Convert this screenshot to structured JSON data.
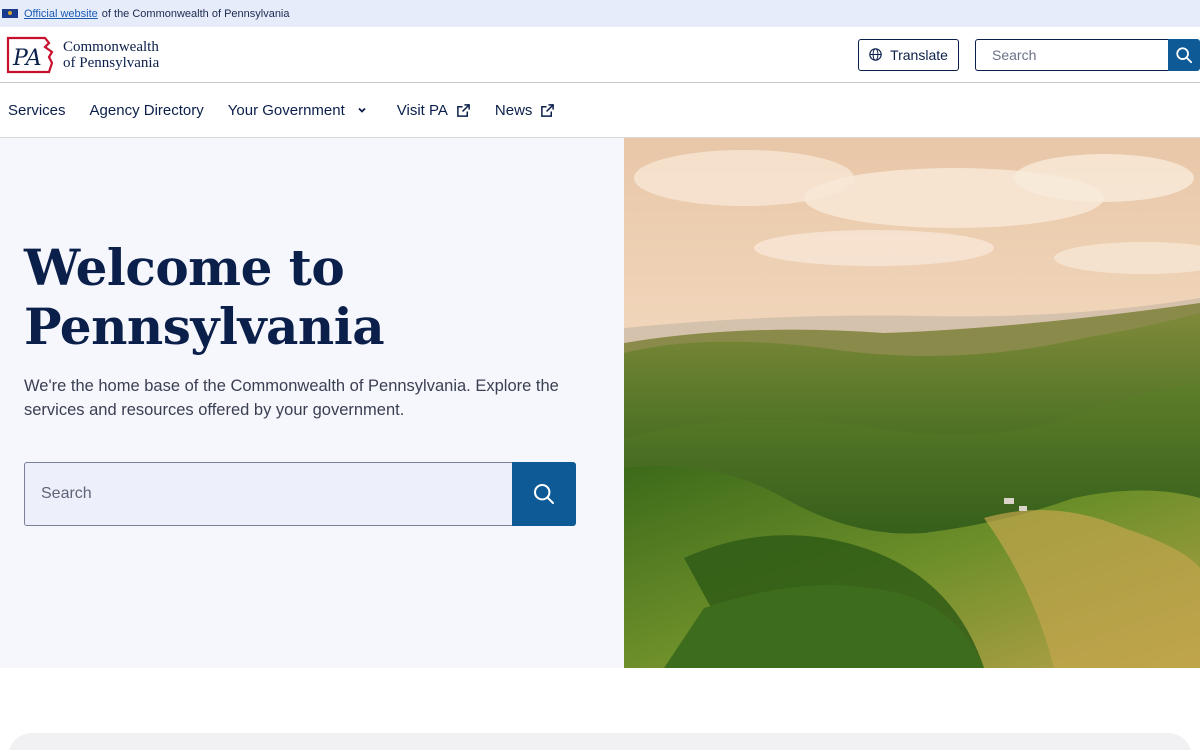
{
  "banner": {
    "link_text": "Official website",
    "rest_text": "of the Commonwealth of Pennsylvania"
  },
  "header": {
    "logo_mark": "PA",
    "logo_line1": "Commonwealth",
    "logo_line2": "of Pennsylvania",
    "translate_label": "Translate",
    "search_placeholder": "Search"
  },
  "nav": {
    "items": [
      {
        "label": "Services",
        "icon": null
      },
      {
        "label": "Agency Directory",
        "icon": null
      },
      {
        "label": "Your Government",
        "icon": "chevron-down-icon"
      },
      {
        "label": "Visit PA",
        "icon": "external-link-icon"
      },
      {
        "label": "News",
        "icon": "external-link-icon"
      }
    ]
  },
  "hero": {
    "title_line1": "Welcome to",
    "title_line2": "Pennsylvania",
    "description": "We're the home base of the Commonwealth of Pennsylvania. Explore the services and resources offered by your government.",
    "search_placeholder": "Search"
  },
  "colors": {
    "navy": "#0b1f4b",
    "accent_blue": "#0e5a96",
    "banner_bg": "#e7ecfb",
    "hero_bg": "#f6f7fc",
    "logo_red": "#c8102e"
  }
}
